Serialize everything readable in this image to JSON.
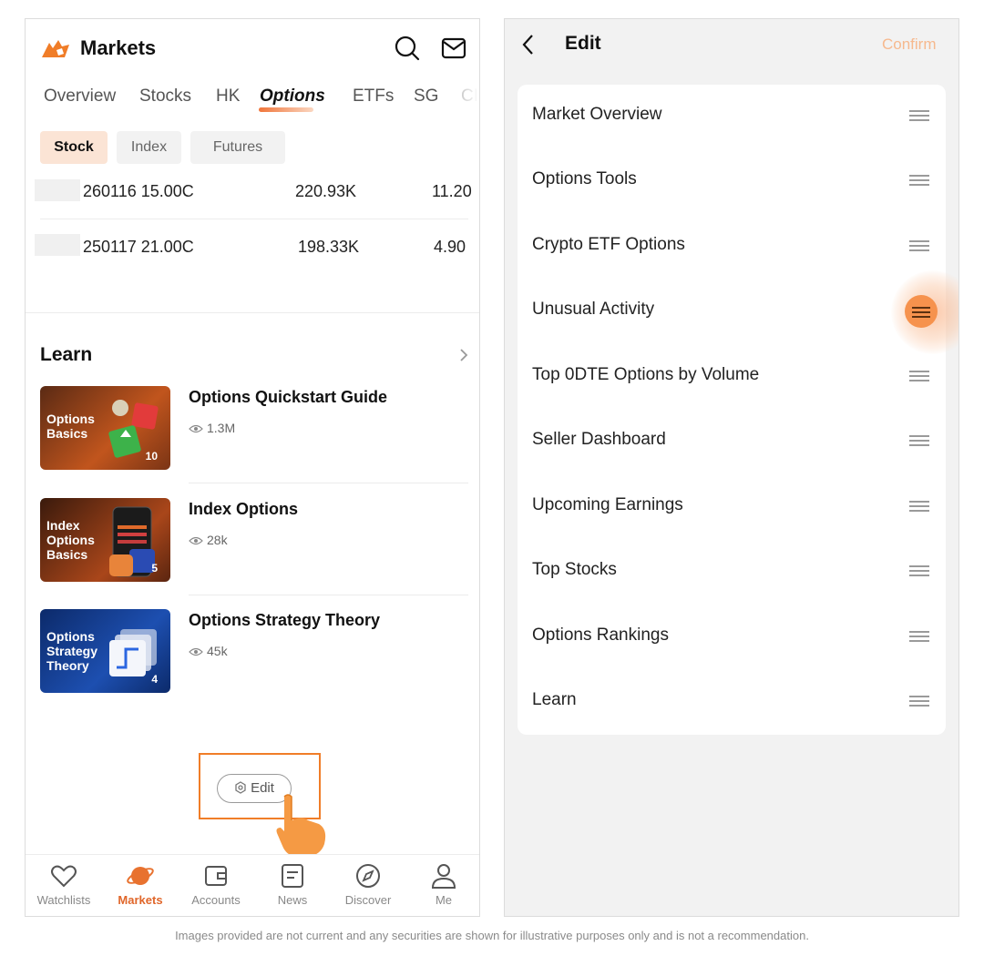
{
  "left": {
    "header": {
      "title": "Markets"
    },
    "tabs": [
      "Overview",
      "Stocks",
      "HK",
      "Options",
      "ETFs",
      "SG",
      "CI"
    ],
    "active_tab": "Options",
    "chips": [
      "Stock",
      "Index",
      "Futures"
    ],
    "active_chip": "Stock",
    "option_rows": [
      {
        "contract": "260116 15.00C",
        "volume": "220.93K",
        "price": "11.20"
      },
      {
        "contract": "250117 21.00C",
        "volume": "198.33K",
        "price": "4.90"
      }
    ],
    "learn": {
      "title": "Learn",
      "cards": [
        {
          "thumb_label": "Options Basics",
          "count": "10",
          "title": "Options Quickstart Guide",
          "views": "1.3M"
        },
        {
          "thumb_label": "Index Options Basics",
          "count": "5",
          "title": "Index Options",
          "views": "28k"
        },
        {
          "thumb_label": "Options Strategy Theory",
          "count": "4",
          "title": "Options Strategy Theory",
          "views": "45k"
        }
      ]
    },
    "edit_button": "Edit",
    "bottom_nav": [
      {
        "label": "Watchlists",
        "icon": "heart-icon"
      },
      {
        "label": "Markets",
        "icon": "planet-icon"
      },
      {
        "label": "Accounts",
        "icon": "wallet-icon"
      },
      {
        "label": "News",
        "icon": "news-icon"
      },
      {
        "label": "Discover",
        "icon": "compass-icon"
      },
      {
        "label": "Me",
        "icon": "user-icon"
      }
    ],
    "active_nav": "Markets"
  },
  "right": {
    "header": {
      "title": "Edit",
      "confirm": "Confirm"
    },
    "items": [
      "Market Overview",
      "Options Tools",
      "Crypto ETF Options",
      "Unusual Activity",
      "Top 0DTE Options by Volume",
      "Seller Dashboard",
      "Upcoming Earnings",
      "Top Stocks",
      "Options Rankings",
      "Learn"
    ],
    "dragging_item": "Unusual Activity"
  },
  "disclaimer": "Images provided are not current and any securities are shown for illustrative purposes only and is not a recommendation.",
  "colors": {
    "accent": "#f07d28",
    "active_chip_bg": "#fbe4d5",
    "confirm_disabled": "#f6b98e",
    "edit_bg": "#f2f2f2"
  }
}
